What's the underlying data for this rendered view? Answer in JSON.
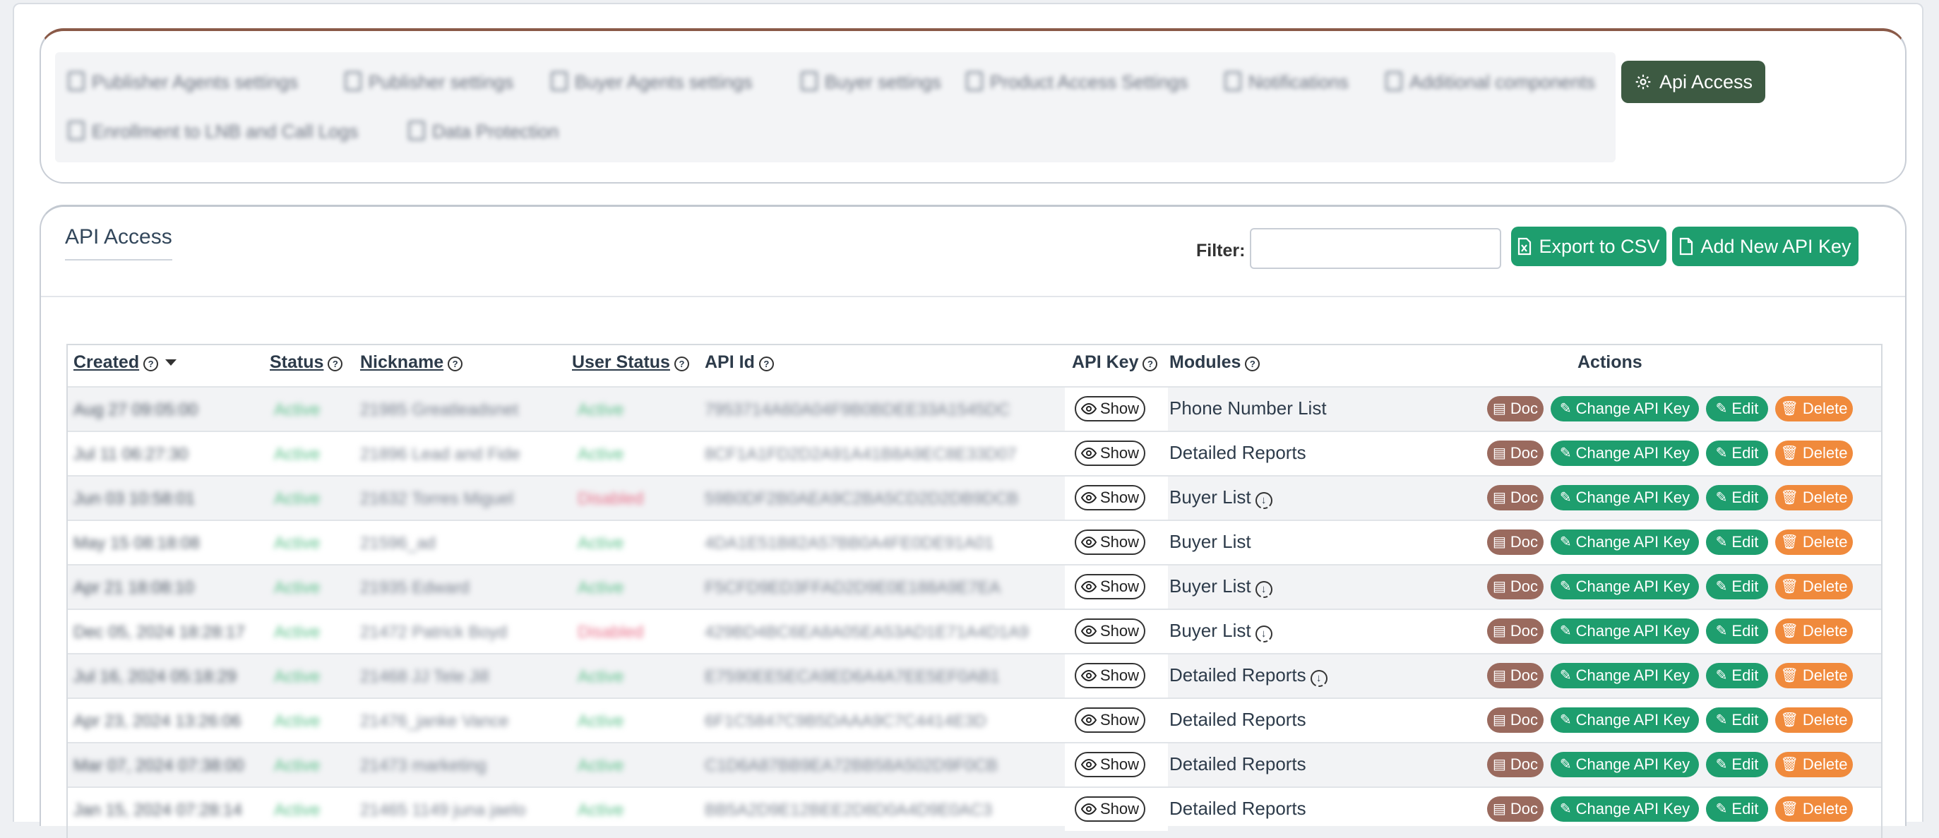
{
  "tabs": {
    "blurred": [
      "Publisher Agents settings",
      "Publisher settings",
      "Buyer Agents settings",
      "Buyer settings",
      "Product Access Settings",
      "Notifications",
      "Additional components",
      "Enrollment to LNB and Call Logs",
      "Data Protection"
    ],
    "active": "Api Access"
  },
  "api": {
    "title": "API Access",
    "filter_label": "Filter:",
    "filter_value": "",
    "export_label": "Export to CSV",
    "add_label": "Add New API Key"
  },
  "table": {
    "headers": {
      "created": "Created",
      "status": "Status",
      "nickname": "Nickname",
      "user_status": "User Status",
      "api_id": "API Id",
      "api_key": "API Key",
      "modules": "Modules",
      "actions": "Actions"
    },
    "show_label": "Show",
    "action_labels": {
      "doc": "Doc",
      "change": "Change API Key",
      "edit": "Edit",
      "delete": "Delete"
    },
    "rows": [
      {
        "created": "Aug 27 09:05:00",
        "status": "Active",
        "nickname": "21985 Greatleadsnet",
        "user_status": "Active",
        "user_status_color": "green",
        "api_id": "7953714A60A04F9B0BDEE33A1545DC",
        "module": "Phone Number List",
        "download": false
      },
      {
        "created": "Jul 11 06:27:30",
        "status": "Active",
        "nickname": "21896 Lead and Fide",
        "user_status": "Active",
        "user_status_color": "green",
        "api_id": "8CF1A1FD2D2A91A41B8A9EC8E33D07",
        "module": "Detailed Reports",
        "download": false
      },
      {
        "created": "Jun 03 10:58:01",
        "status": "Active",
        "nickname": "21632 Torres Miguel",
        "user_status": "Disabled",
        "user_status_color": "red",
        "api_id": "59B0DF2B0AEA9C2BA5CD2D2DB9DCB",
        "module": "Buyer List",
        "download": true
      },
      {
        "created": "May 15 08:18:08",
        "status": "Active",
        "nickname": "21596_ad",
        "user_status": "Active",
        "user_status_color": "green",
        "api_id": "4DA1E51B82A57BB0A4FE0DE91A01",
        "module": "Buyer List",
        "download": false
      },
      {
        "created": "Apr 21 18:08:10",
        "status": "Active",
        "nickname": "21935 Edward",
        "user_status": "Active",
        "user_status_color": "green",
        "api_id": "F5CFD9ED3FFAD2D9E0E188A9E7EA",
        "module": "Buyer List",
        "download": true
      },
      {
        "created": "Dec 05, 2024 18:28:17",
        "status": "Active",
        "nickname": "21472 Patrick Boyd",
        "user_status": "Disabled",
        "user_status_color": "red",
        "api_id": "429BD4BC6EA8A05EA53AD1E71A4D1A9",
        "module": "Buyer List",
        "download": true
      },
      {
        "created": "Jul 16, 2024 05:18:29",
        "status": "Active",
        "nickname": "21468 JJ Tele Jill",
        "user_status": "Active",
        "user_status_color": "green",
        "api_id": "E7590EE5ECA9ED6A4A7EE5EF0AB1",
        "module": "Detailed Reports",
        "download": true
      },
      {
        "created": "Apr 23, 2024 13:26:06",
        "status": "Active",
        "nickname": "21476_janke Vance",
        "user_status": "Active",
        "user_status_color": "green",
        "api_id": "6F1C5847C9B5DAAA9C7C4414E3D",
        "module": "Detailed Reports",
        "download": false
      },
      {
        "created": "Mar 07, 2024 07:38:00",
        "status": "Active",
        "nickname": "21473 marketing",
        "user_status": "Active",
        "user_status_color": "green",
        "api_id": "C1D6A87BB9EA72BB58A502D9F0CB",
        "module": "Detailed Reports",
        "download": false
      },
      {
        "created": "Jan 15, 2024 07:28:14",
        "status": "Active",
        "nickname": "21465 1149 juna jaelo",
        "user_status": "Active",
        "user_status_color": "green",
        "api_id": "BB5A2D9E12BEE2D8D0A4D9E0AC3",
        "module": "Detailed Reports",
        "download": false
      }
    ]
  },
  "colors": {
    "active_tab": "#3d5a42",
    "green_button": "#1e9e6e",
    "doc_button": "#9a6a5e",
    "delete_button": "#f08a3c",
    "card_top_border": "#8a5a48"
  }
}
